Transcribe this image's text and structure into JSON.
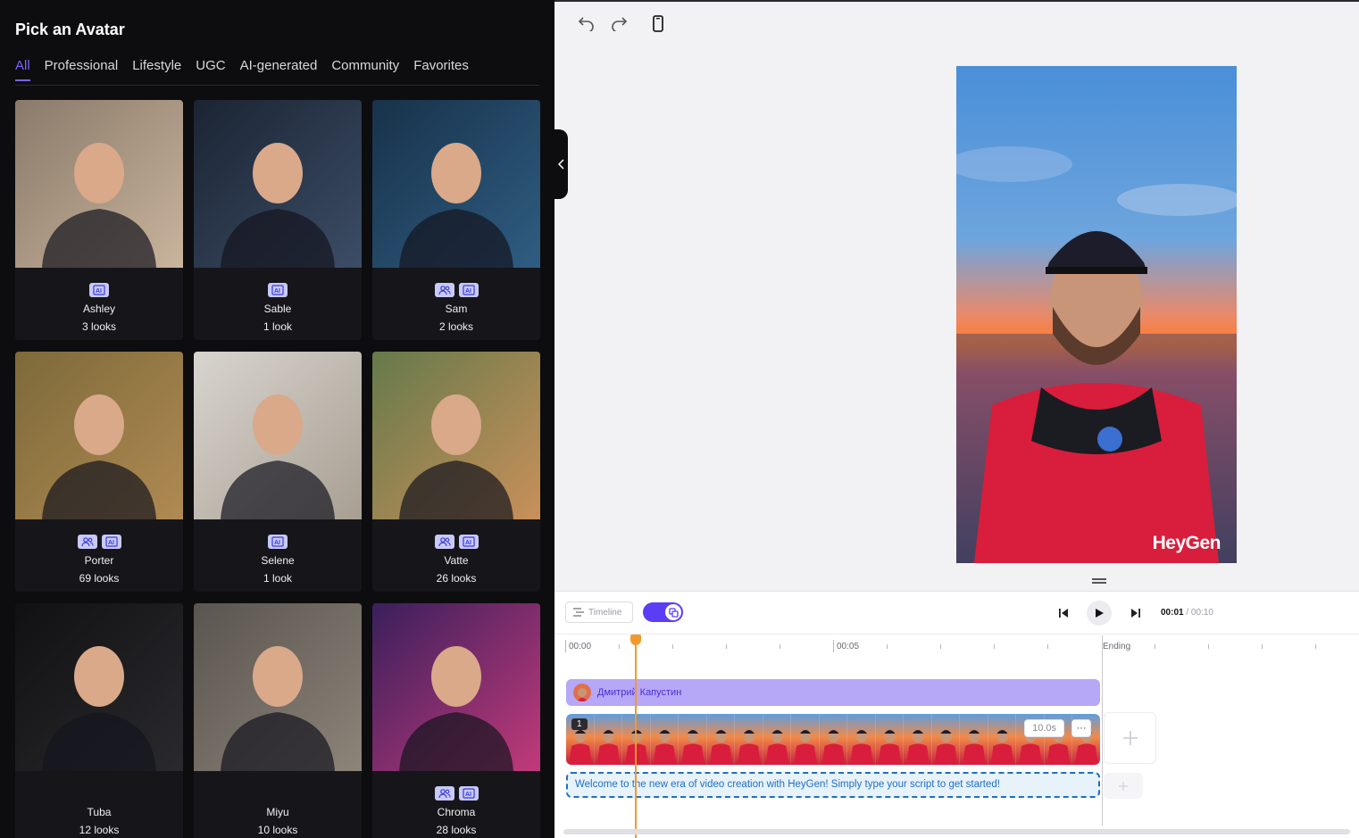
{
  "panel": {
    "title": "Pick an Avatar",
    "tabs": [
      "All",
      "Professional",
      "Lifestyle",
      "UGC",
      "AI-generated",
      "Community",
      "Favorites"
    ]
  },
  "avatars": [
    {
      "name": "Ashley",
      "looks": "3 looks",
      "badges": [
        "ai-icon"
      ],
      "colors": [
        "#8a7a6a",
        "#c9b49d"
      ]
    },
    {
      "name": "Sable",
      "looks": "1 look",
      "badges": [
        "ai-icon"
      ],
      "colors": [
        "#1b2433",
        "#3c4d66"
      ]
    },
    {
      "name": "Sam",
      "looks": "2 looks",
      "badges": [
        "people-icon",
        "ai-icon"
      ],
      "colors": [
        "#18324a",
        "#2f5d82"
      ]
    },
    {
      "name": "Porter",
      "looks": "69 looks",
      "badges": [
        "people-icon",
        "ai-icon"
      ],
      "colors": [
        "#7d6a3a",
        "#b08a52"
      ]
    },
    {
      "name": "Selene",
      "looks": "1 look",
      "badges": [
        "ai-icon"
      ],
      "colors": [
        "#d8d4cf",
        "#a89f92"
      ]
    },
    {
      "name": "Vatte",
      "looks": "26 looks",
      "badges": [
        "people-icon",
        "ai-icon"
      ],
      "colors": [
        "#667a4a",
        "#c9905a"
      ]
    },
    {
      "name": "Tuba",
      "looks": "12 looks",
      "badges": [],
      "colors": [
        "#111113",
        "#2a2a2e"
      ]
    },
    {
      "name": "Miyu",
      "looks": "10 looks",
      "badges": [],
      "colors": [
        "#5a5550",
        "#8d8479"
      ]
    },
    {
      "name": "Chroma",
      "looks": "28 looks",
      "badges": [
        "people-icon",
        "ai-icon"
      ],
      "colors": [
        "#3a1f5c",
        "#c23a7a"
      ]
    }
  ],
  "preview": {
    "watermark": "HeyGen"
  },
  "timeline": {
    "button_label": "Timeline",
    "current_time": "00:01",
    "duration": "/ 00:10",
    "ruler": [
      "00:00",
      "00:05",
      "Ending"
    ],
    "avatar_name": "Дмитрий Капустин",
    "clip_number": "1",
    "clip_duration": "10.0s",
    "more": "···",
    "script": "Welcome to the new era of video creation with HeyGen! Simply type your script to get started!"
  },
  "colors": {
    "accent": "#5b3df5",
    "playhead": "#f29a2e",
    "script": "#1f6fc2"
  }
}
